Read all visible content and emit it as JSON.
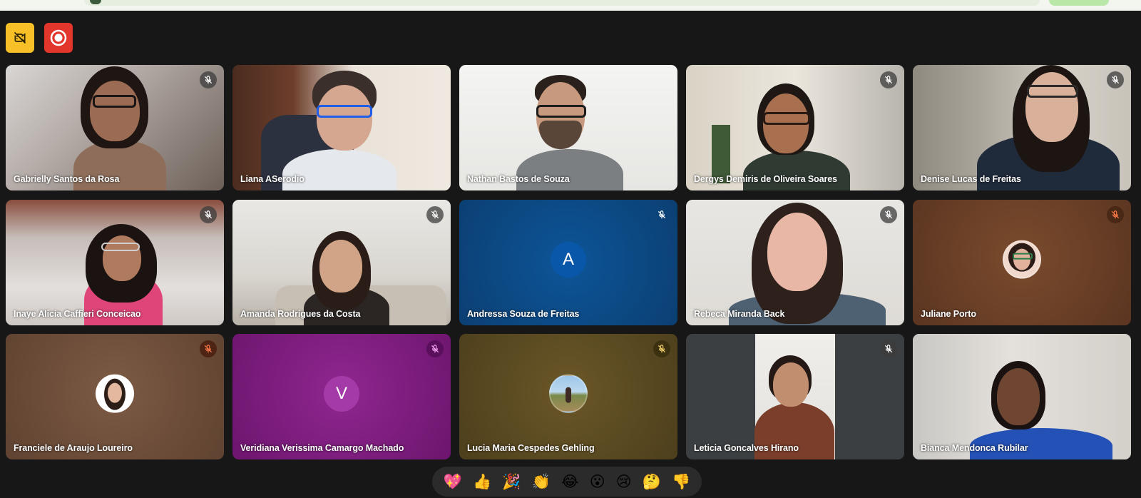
{
  "toolbar": {
    "camera_off_icon": "camera-off-icon",
    "record_icon": "record-icon"
  },
  "participants": [
    {
      "name": "Gabrielly Santos da Rosa",
      "muted": true
    },
    {
      "name": "Liana ASerodio",
      "muted": false
    },
    {
      "name": "Nathan Bastos de Souza",
      "muted": false
    },
    {
      "name": "Dergys Demiris de Oliveira Soares",
      "muted": true
    },
    {
      "name": "Denise Lucas de Freitas",
      "muted": true
    },
    {
      "name": "Inaye Alicia Caffieri Conceicao",
      "muted": true
    },
    {
      "name": "Amanda Rodrigues da Costa",
      "muted": true
    },
    {
      "name": "Andressa Souza de Freitas",
      "muted": true,
      "initial": "A",
      "color": "#0b4f93"
    },
    {
      "name": "Rebeca Miranda Back",
      "muted": true
    },
    {
      "name": "Juliane Porto",
      "muted": true,
      "color": "#6b4126"
    },
    {
      "name": "Franciele de Araujo Loureiro",
      "muted": true,
      "color": "#6b4a35"
    },
    {
      "name": "Veridiana Verissima Camargo Machado",
      "muted": true,
      "initial": "V",
      "color": "#8a1f86"
    },
    {
      "name": "Lucia Maria Cespedes Gehling",
      "muted": true,
      "color": "#5b4a22"
    },
    {
      "name": "Leticia Goncalves Hirano",
      "muted": true
    },
    {
      "name": "Bianca Mendonca Rubilar",
      "muted": false
    }
  ],
  "reactions": [
    "💖",
    "👍",
    "🎉",
    "👏",
    "😂",
    "😮",
    "😢",
    "🤔",
    "👎"
  ]
}
